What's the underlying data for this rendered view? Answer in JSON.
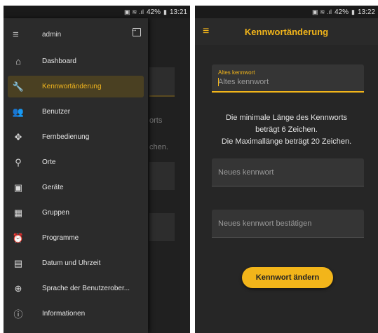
{
  "left": {
    "status": {
      "battery": "42%",
      "time": "13:21"
    },
    "drawer": {
      "user": "admin",
      "items": [
        {
          "label": "Dashboard",
          "icon": "home-icon",
          "glyph": "⌂",
          "active": false
        },
        {
          "label": "Kennwortänderung",
          "icon": "wrench-icon",
          "glyph": "🔧",
          "active": true
        },
        {
          "label": "Benutzer",
          "icon": "users-icon",
          "glyph": "👥",
          "active": false
        },
        {
          "label": "Fernbedienung",
          "icon": "gamepad-icon",
          "glyph": "✥",
          "active": false
        },
        {
          "label": "Orte",
          "icon": "location-pin-icon",
          "glyph": "⚲",
          "active": false
        },
        {
          "label": "Geräte",
          "icon": "chip-icon",
          "glyph": "▣",
          "active": false
        },
        {
          "label": "Gruppen",
          "icon": "grid-icon",
          "glyph": "▦",
          "active": false
        },
        {
          "label": "Programme",
          "icon": "alarm-clock-icon",
          "glyph": "⏰",
          "active": false
        },
        {
          "label": "Datum und Uhrzeit",
          "icon": "calendar-icon",
          "glyph": "▤",
          "active": false
        },
        {
          "label": "Sprache der Benutzerober...",
          "icon": "globe-icon",
          "glyph": "⊕",
          "active": false
        },
        {
          "label": "Informationen",
          "icon": "info-icon",
          "glyph": "ⓘ",
          "active": false
        }
      ]
    },
    "background": {
      "text1": "orts",
      "text2": "chen."
    }
  },
  "right": {
    "status": {
      "battery": "42%",
      "time": "13:22"
    },
    "title": "Kennwortänderung",
    "old_password": {
      "label": "Altes kennwort",
      "placeholder": "Altes kennwort"
    },
    "info_line1": "Die minimale Länge des Kennworts",
    "info_line2": "beträgt 6 Zeichen.",
    "info_line3": "Die Maximallänge beträgt 20 Zeichen.",
    "new_password": {
      "placeholder": "Neues kennwort"
    },
    "confirm_password": {
      "placeholder": "Neues kennwort bestätigen"
    },
    "submit_label": "Kennwort ändern"
  },
  "colors": {
    "accent": "#f2b51a",
    "background": "#262626",
    "drawer": "#2b2b2b"
  }
}
